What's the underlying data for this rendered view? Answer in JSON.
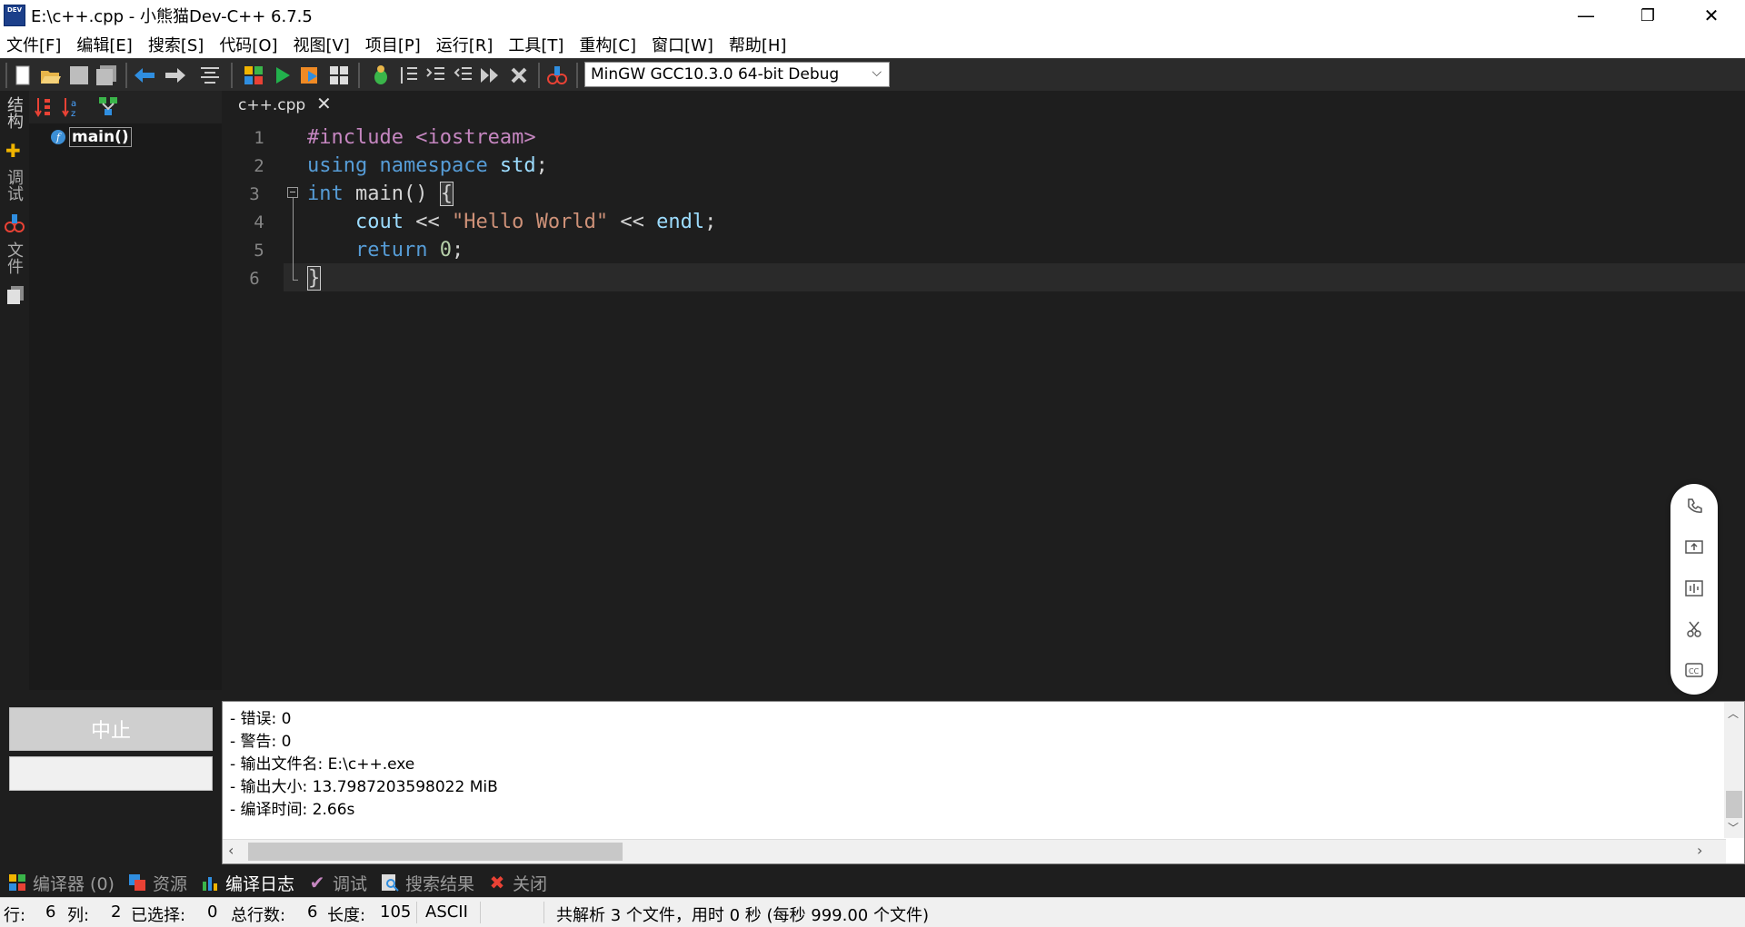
{
  "window": {
    "title": "E:\\c++.cpp - 小熊猫Dev-C++ 6.7.5",
    "app_icon_text": "DEV",
    "minimize": "—",
    "restore": "❐",
    "close": "✕"
  },
  "menu": [
    "文件[F]",
    "编辑[E]",
    "搜索[S]",
    "代码[O]",
    "视图[V]",
    "项目[P]",
    "运行[R]",
    "工具[T]",
    "重构[C]",
    "窗口[W]",
    "帮助[H]"
  ],
  "toolbar": {
    "compiler_selected": "MinGW GCC10.3.0 64-bit Debug"
  },
  "left_tabs": [
    "结构",
    "调试",
    "文件"
  ],
  "class_browser": {
    "function_icon": "f",
    "function_name": "main()"
  },
  "editor": {
    "tab_name": "c++.cpp",
    "tab_close": "✕",
    "line_numbers": [
      "1",
      "2",
      "3",
      "4",
      "5",
      "6"
    ],
    "code": {
      "l1_directive": "#include",
      "l1_header": " <iostream>",
      "l2_using": "using",
      "l2_namespace": " namespace",
      "l2_std": " std",
      "l2_semi": ";",
      "l3_int": "int",
      "l3_main": " main",
      "l3_parens": "() ",
      "l3_brace": "{",
      "l4_cout": "    cout",
      "l4_op1": " << ",
      "l4_str": "\"Hello World\"",
      "l4_op2": " << ",
      "l4_endl": "endl",
      "l4_semi": ";",
      "l5_return": "    return",
      "l5_zero": " 0",
      "l5_semi": ";",
      "l6_brace": "}"
    }
  },
  "float_panel": [
    "phone-icon",
    "upload-screen-icon",
    "audio-wave-icon",
    "scissors-icon",
    "captions-icon"
  ],
  "bottom_left": {
    "abort_label": "中止"
  },
  "compile_log": [
    "- 错误: 0",
    "- 警告: 0",
    "- 输出文件名: E:\\c++.exe",
    "- 输出大小: 13.7987203598022 MiB",
    "- 编译时间: 2.66s"
  ],
  "bottom_tabs": [
    {
      "label": "编译器 (0)",
      "icon": "grid-icon"
    },
    {
      "label": "资源",
      "icon": "resources-icon"
    },
    {
      "label": "编译日志",
      "icon": "chart-icon",
      "active": true
    },
    {
      "label": "调试",
      "icon": "check-icon"
    },
    {
      "label": "搜索结果",
      "icon": "search-results-icon"
    },
    {
      "label": "关闭",
      "icon": "close-icon"
    }
  ],
  "status": {
    "row_label": "行:",
    "row_value": "6",
    "col_label": "列:",
    "col_value": "2",
    "selected_label": "已选择:",
    "selected_value": "0",
    "total_lines_label": "总行数:",
    "total_lines_value": "6",
    "length_label": "长度:",
    "length_value": "105",
    "encoding": "ASCII",
    "parse_message": "共解析 3 个文件，用时 0 秒 (每秒 999.00 个文件)"
  }
}
